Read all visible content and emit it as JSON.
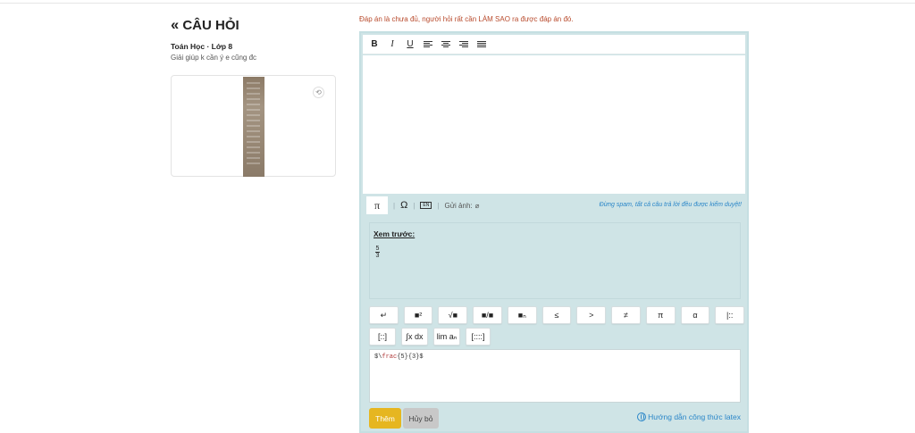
{
  "question": {
    "back_label": "CÂU HỎI",
    "subject": "Toán Học · Lớp 8",
    "text": "Giải giúp k cần ý e cũng đc"
  },
  "answer": {
    "warning": "Đáp án là chưa đủ, người hỏi rất cần LÀM SAO ra được đáp án đó.",
    "toolbar": {
      "bold": "B",
      "italic": "I",
      "underline": "U"
    },
    "tabs": {
      "pi": "π",
      "omega": "Ω",
      "keyboard": "EN",
      "send_image": "Gửi ảnh:"
    },
    "spam_notice": "Đừng spam, tất cả câu trả lời đều được kiểm duyệt!",
    "preview": {
      "title": "Xem trước:",
      "numerator": "5",
      "denominator": "3"
    },
    "keys_row1": [
      "↵",
      "■²",
      "√■",
      "■/■",
      "■ₙ",
      "≤",
      ">",
      "≠",
      "π",
      "α",
      "|::"
    ],
    "keys_row2": [
      "[::]",
      "∫x dx",
      "lim aₙ",
      "[::::]"
    ],
    "latex_prefix": "$\\",
    "latex_command": "frac",
    "latex_args": "{5}{3}$",
    "add_button": "Thêm",
    "cancel_button": "Hủy bỏ",
    "guide_link": "Hướng dẫn công thức latex"
  }
}
